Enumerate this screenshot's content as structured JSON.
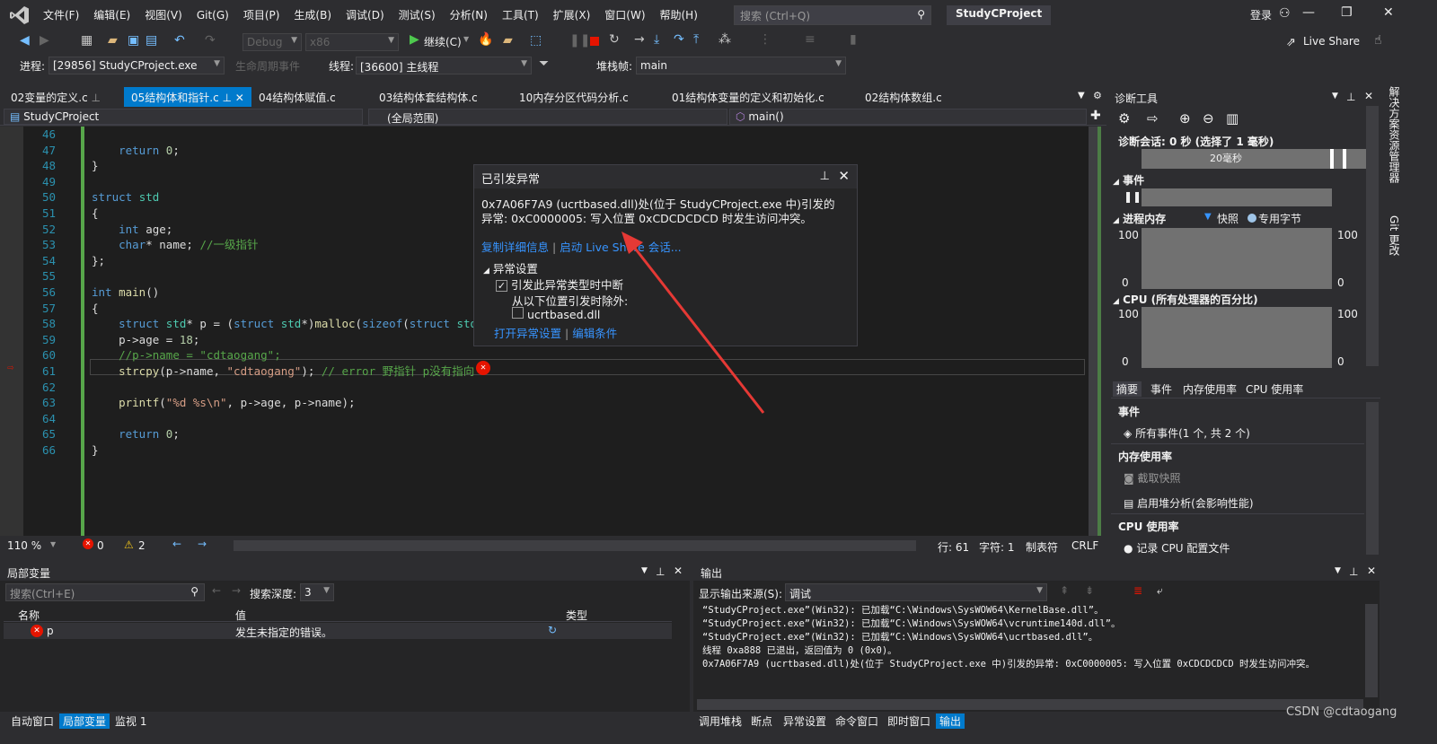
{
  "menu": [
    "文件(F)",
    "编辑(E)",
    "视图(V)",
    "Git(G)",
    "项目(P)",
    "生成(B)",
    "调试(D)",
    "测试(S)",
    "分析(N)",
    "工具(T)",
    "扩展(X)",
    "窗口(W)",
    "帮助(H)"
  ],
  "search_placeholder": "搜索 (Ctrl+Q)",
  "project_name": "StudyCProject",
  "login": "登录",
  "toolbar": {
    "config": "Debug",
    "platform": "x86",
    "continue": "继续(C)",
    "live_share": "Live Share"
  },
  "debugbar": {
    "process_label": "进程:",
    "process_value": "[29856] StudyCProject.exe",
    "lifecycle": "生命周期事件",
    "thread_label": "线程:",
    "thread_value": "[36600] 主线程",
    "stack_label": "堆栈帧:",
    "stack_value": "main"
  },
  "tabs": [
    "02变量的定义.c",
    "05结构体和指针.c",
    "04结构体赋值.c",
    "03结构体套结构体.c",
    "10内存分区代码分析.c",
    "01结构体变量的定义和初始化.c",
    "02结构体数组.c"
  ],
  "nav": {
    "project": "StudyCProject",
    "scope": "(全局范围)",
    "func": "main()"
  },
  "code_lines": [
    "46",
    "47",
    "48",
    "49",
    "50",
    "51",
    "52",
    "53",
    "54",
    "55",
    "56",
    "57",
    "58",
    "59",
    "60",
    "61",
    "62",
    "63",
    "64",
    "65",
    "66"
  ],
  "exception": {
    "title": "已引发异常",
    "msg1": "0x7A06F7A9 (ucrtbased.dll)处(位于 StudyCProject.exe 中)引发的",
    "msg2": "异常: 0xC0000005: 写入位置 0xCDCDCDCD 时发生访问冲突。",
    "link_copy": "复制详细信息",
    "link_live": "启动 Live Share 会话...",
    "settings_title": "异常设置",
    "check_break": "引发此异常类型时中断",
    "except_from": "从以下位置引发时除外:",
    "dll": "ucrtbased.dll",
    "link_open": "打开异常设置",
    "link_edit": "编辑条件"
  },
  "edstatus": {
    "zoom": "110 %",
    "errors": "0",
    "warnings": "2",
    "line": "行: 61",
    "char": "字符: 1",
    "tab": "制表符",
    "crlf": "CRLF"
  },
  "diag": {
    "title": "诊断工具",
    "session": "诊断会话: 0 秒 (选择了 1 毫秒)",
    "timeline": "20毫秒",
    "events": "事件",
    "mem": "进程内存",
    "snapshot": "快照",
    "private": "专用字节",
    "cpu": "CPU (所有处理器的百分比)",
    "y100": "100",
    "y0": "0",
    "tabs": [
      "摘要",
      "事件",
      "内存使用率",
      "CPU 使用率"
    ],
    "sec_events": "事件",
    "all_events": "所有事件(1 个, 共 2 个)",
    "sec_mem": "内存使用率",
    "take_snapshot": "截取快照",
    "heap": "启用堆分析(会影响性能)",
    "sec_cpu": "CPU 使用率",
    "record_cpu": "记录 CPU 配置文件"
  },
  "side_strip": [
    "解决方案资源管理器",
    "Git 更改"
  ],
  "locals": {
    "title": "局部变量",
    "search": "搜索(Ctrl+E)",
    "depth_label": "搜索深度:",
    "depth": "3",
    "col_name": "名称",
    "col_value": "值",
    "col_type": "类型",
    "row_name": "p",
    "row_value": "发生未指定的错误。"
  },
  "output": {
    "title": "输出",
    "source_label": "显示输出来源(S):",
    "source": "调试",
    "lines": [
      "“StudyCProject.exe”(Win32): 已加载“C:\\Windows\\SysWOW64\\KernelBase.dll”。",
      "“StudyCProject.exe”(Win32): 已加载“C:\\Windows\\SysWOW64\\vcruntime140d.dll”。",
      "“StudyCProject.exe”(Win32): 已加载“C:\\Windows\\SysWOW64\\ucrtbased.dll”。",
      "线程 0xa888 已退出，返回值为 0 (0x0)。",
      "0x7A06F7A9 (ucrtbased.dll)处(位于 StudyCProject.exe 中)引发的异常: 0xC0000005: 写入位置 0xCDCDCDCD 时发生访问冲突。"
    ]
  },
  "bottom_tabs_left": [
    "自动窗口",
    "局部变量",
    "监视 1"
  ],
  "bottom_tabs_right": [
    "调用堆栈",
    "断点",
    "异常设置",
    "命令窗口",
    "即时窗口",
    "输出"
  ],
  "watermark": "CSDN @cdtaogang",
  "colors": {
    "accent": "#007acc",
    "error": "#e51400",
    "arrow": "#e53935"
  }
}
